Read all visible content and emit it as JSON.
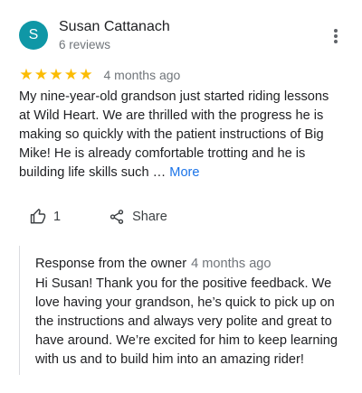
{
  "reviewer": {
    "initial": "S",
    "name": "Susan Cattanach",
    "meta": "6 reviews",
    "avatar_color": "#0f97a6"
  },
  "review": {
    "rating": 5,
    "rating_max": 5,
    "stars": [
      "★",
      "★",
      "★",
      "★",
      "★"
    ],
    "star_color": "#fbbc04",
    "date": "4 months ago",
    "text": "My nine-year-old grandson just started riding lessons at Wild Heart. We are thrilled with the progress he is making so quickly with the patient instructions of Big Mike! He is already comfortable trotting and he is building life skills such … ",
    "more_label": "More"
  },
  "actions": {
    "like_icon": "thumbs-up-icon",
    "like_count": "1",
    "share_icon": "share-icon",
    "share_label": "Share"
  },
  "response": {
    "title": "Response from the owner",
    "date": "4 months ago",
    "text": "Hi Susan! Thank you for the positive feedback. We love having your grandson, he’s quick to pick up on the instructions and always very polite and great to have around. We’re excited for him to keep learning with us and to build him into an amazing rider!"
  },
  "menu_icon": "more-vert-icon",
  "colors": {
    "link": "#1a73e8",
    "secondary_text": "#70757a",
    "primary_text": "#202124"
  }
}
